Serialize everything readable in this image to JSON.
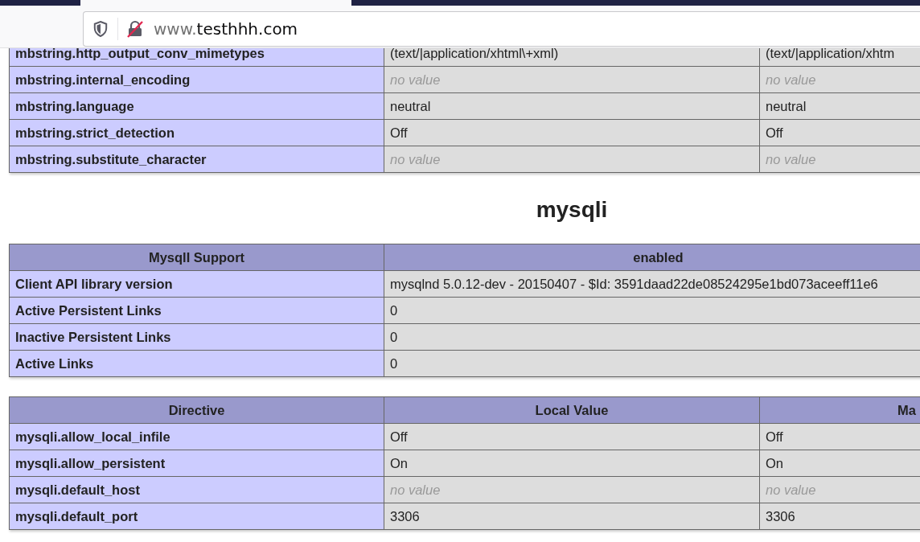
{
  "browser": {
    "url_prefix": "www.",
    "url_domain": "testhhh.com"
  },
  "mbstring_table": {
    "rows": [
      {
        "name": "mbstring.http_output_conv_mimetypes",
        "local": {
          "text": "(text/|application/xhtml\\+xml)",
          "kind": "value"
        },
        "master": {
          "text": "(text/|application/xhtm",
          "kind": "value"
        }
      },
      {
        "name": "mbstring.internal_encoding",
        "local": {
          "text": "no value",
          "kind": "empty"
        },
        "master": {
          "text": "no value",
          "kind": "empty"
        }
      },
      {
        "name": "mbstring.language",
        "local": {
          "text": "neutral",
          "kind": "value"
        },
        "master": {
          "text": "neutral",
          "kind": "value"
        }
      },
      {
        "name": "mbstring.strict_detection",
        "local": {
          "text": "Off",
          "kind": "value"
        },
        "master": {
          "text": "Off",
          "kind": "value"
        }
      },
      {
        "name": "mbstring.substitute_character",
        "local": {
          "text": "no value",
          "kind": "empty"
        },
        "master": {
          "text": "no value",
          "kind": "empty"
        }
      }
    ]
  },
  "section_title": "mysqli",
  "mysqli_info": {
    "header": {
      "name": "MysqlI Support",
      "value": "enabled"
    },
    "rows": [
      {
        "name": "Client API library version",
        "value": "mysqlnd 5.0.12-dev - 20150407 - $Id: 3591daad22de08524295e1bd073aceeff11e6"
      },
      {
        "name": "Active Persistent Links",
        "value": "0"
      },
      {
        "name": "Inactive Persistent Links",
        "value": "0"
      },
      {
        "name": "Active Links",
        "value": "0"
      }
    ]
  },
  "mysqli_directives": {
    "columns": [
      "Directive",
      "Local Value",
      "Ma"
    ],
    "rows": [
      {
        "name": "mysqli.allow_local_infile",
        "local": {
          "text": "Off",
          "kind": "value"
        },
        "master": {
          "text": "Off",
          "kind": "value"
        }
      },
      {
        "name": "mysqli.allow_persistent",
        "local": {
          "text": "On",
          "kind": "value"
        },
        "master": {
          "text": "On",
          "kind": "value"
        }
      },
      {
        "name": "mysqli.default_host",
        "local": {
          "text": "no value",
          "kind": "empty"
        },
        "master": {
          "text": "no value",
          "kind": "empty"
        }
      },
      {
        "name": "mysqli.default_port",
        "local": {
          "text": "3306",
          "kind": "value"
        },
        "master": {
          "text": "3306",
          "kind": "value"
        }
      }
    ]
  }
}
